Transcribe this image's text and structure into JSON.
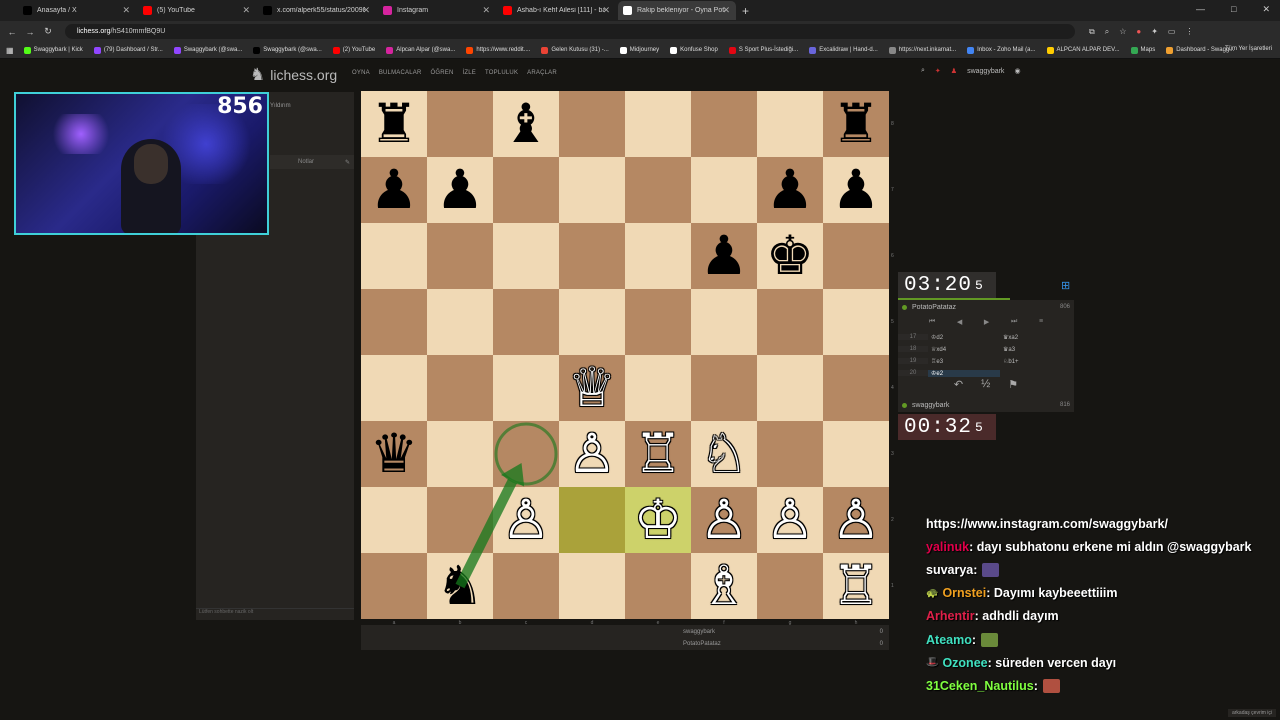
{
  "browser": {
    "tabs": [
      {
        "title": "Anasayfa / X",
        "color": "#000000",
        "active": false
      },
      {
        "title": "(5) YouTube",
        "color": "#ff0000",
        "active": false
      },
      {
        "title": "x.com/alperk55/status/200989...",
        "color": "#000000",
        "active": false
      },
      {
        "title": "Instagram",
        "color": "#d6249f",
        "active": false
      },
      {
        "title": "Ashab-ı Kehf Ailesi [111] - baş...",
        "color": "#ff0000",
        "active": false
      },
      {
        "title": "Rakip bekleniyor - Oyna Potato...",
        "color": "#ffffff",
        "active": true
      }
    ],
    "url_host": "lichess.org",
    "url_path": "/hS410mmfBQ9U",
    "bookmarks": [
      {
        "label": "Swaggybark | Kick",
        "color": "#53fc18"
      },
      {
        "label": "(79) Dashboard / Str...",
        "color": "#9146ff"
      },
      {
        "label": "Swaggybark (@swa...",
        "color": "#9146ff"
      },
      {
        "label": "Swaggybark (@swa...",
        "color": "#000000"
      },
      {
        "label": "(2) YouTube",
        "color": "#ff0000"
      },
      {
        "label": "Alpcan Alpar (@swa...",
        "color": "#d6249f"
      },
      {
        "label": "https://www.reddit....",
        "color": "#ff4500"
      },
      {
        "label": "Gelen Kutusu (31) -...",
        "color": "#ea4335"
      },
      {
        "label": "Midjourney",
        "color": "#ffffff"
      },
      {
        "label": "Konfuse Shop",
        "color": "#ffffff"
      },
      {
        "label": "S Sport Plus-İstediği...",
        "color": "#e30613"
      },
      {
        "label": "Excalidraw | Hand-d...",
        "color": "#6965db"
      },
      {
        "label": "https://next.inkarnat...",
        "color": "#888888"
      },
      {
        "label": "Inbox - Zoho Mail (a...",
        "color": "#4285f4"
      },
      {
        "label": "ALPCAN ALPAR DEV...",
        "color": "#ffcc00"
      },
      {
        "label": "Maps",
        "color": "#34a853"
      },
      {
        "label": "Dashboard - Swagg...",
        "color": "#f0a030"
      }
    ],
    "bookmarks_right": "Tüm Yer İşaretleri"
  },
  "lichess": {
    "logo": "lichess.org",
    "nav": [
      "OYNA",
      "BULMACALAR",
      "ÖĞREN",
      "İZLE",
      "TOPLULUK",
      "ARAÇLAR"
    ],
    "username": "swaggybark",
    "game_type": "Yıldırım",
    "notes_tab": "Notlar",
    "chat_placeholder": "Lütfen sohbette nazik olt",
    "files": [
      "a",
      "b",
      "c",
      "d",
      "e",
      "f",
      "g",
      "h"
    ],
    "ranks": [
      "8",
      "7",
      "6",
      "5",
      "4",
      "3",
      "2",
      "1"
    ]
  },
  "webcam": {
    "rating": "856"
  },
  "board": {
    "rows": [
      [
        "bR",
        "",
        "bB",
        "",
        "",
        "",
        "",
        "bR"
      ],
      [
        "bP",
        "bP",
        "",
        "",
        "",
        "",
        "bP",
        "bP"
      ],
      [
        "",
        "",
        "",
        "",
        "",
        "bP",
        "bK",
        ""
      ],
      [
        "",
        "",
        "",
        "",
        "",
        "",
        "",
        ""
      ],
      [
        "",
        "",
        "",
        "wQ",
        "",
        "",
        "",
        ""
      ],
      [
        "bQ",
        "",
        "",
        "wP",
        "wR",
        "wN",
        "",
        ""
      ],
      [
        "",
        "",
        "wP",
        "",
        "wK",
        "wP",
        "wP",
        "wP"
      ],
      [
        "",
        "bN",
        "",
        "",
        "",
        "wB",
        "",
        "wR"
      ]
    ],
    "highlight_squares": [
      "d2",
      "e2"
    ],
    "arrow": {
      "from": "b1",
      "to": "c3",
      "color": "#15781b"
    }
  },
  "opponent": {
    "name": "PotatoPatataz",
    "rating": "806",
    "clock_main": "03:20",
    "clock_tenth": "5"
  },
  "player": {
    "name": "swaggybark",
    "rating": "816",
    "clock_main": "00:32",
    "clock_tenth": "5"
  },
  "moves": [
    {
      "n": "17",
      "w": "♔d2",
      "b": "♛xa2"
    },
    {
      "n": "18",
      "w": "♕xd4",
      "b": "♛a3"
    },
    {
      "n": "19",
      "w": "♖e3",
      "b": "♘b1+"
    },
    {
      "n": "20",
      "w": "♔e2",
      "b": ""
    }
  ],
  "below_board": [
    {
      "name": "swaggybark",
      "score": "0"
    },
    {
      "name": "PotatoPatataz",
      "score": "0"
    }
  ],
  "chat": [
    {
      "user": "",
      "user_color": "#ffffff",
      "text": "https://www.instagram.com/swaggybark/",
      "emote": "",
      "badge": ""
    },
    {
      "user": "yalinuk",
      "user_color": "#e0004a",
      "text": ": dayı subhatonu erkene mi aldın @swaggybark",
      "emote": "",
      "badge": ""
    },
    {
      "user": "suvarya",
      "user_color": "#ffffff",
      "text": " : ",
      "emote": "#5a4a8a",
      "badge": ""
    },
    {
      "user": "Ornstei",
      "user_color": "#f0a020",
      "text": " : Dayımı kaybeeettiiim",
      "emote": "",
      "badge": "🐢"
    },
    {
      "user": "Arhentir",
      "user_color": "#e0204a",
      "text": " : adhdli dayım",
      "emote": "",
      "badge": ""
    },
    {
      "user": "Ateamo",
      "user_color": "#40e0c0",
      "text": " : ",
      "emote": "#6a8a3a",
      "badge": ""
    },
    {
      "user": "Ozonee",
      "user_color": "#40e0c0",
      "text": " : süreden vercen dayı",
      "emote": "",
      "badge": "🎩"
    },
    {
      "user": "31Ceken_Nautilus",
      "user_color": "#80ff40",
      "text": " : ",
      "emote": "#b05040",
      "badge": ""
    }
  ],
  "friends_online": "arkadaş çevrim içi"
}
